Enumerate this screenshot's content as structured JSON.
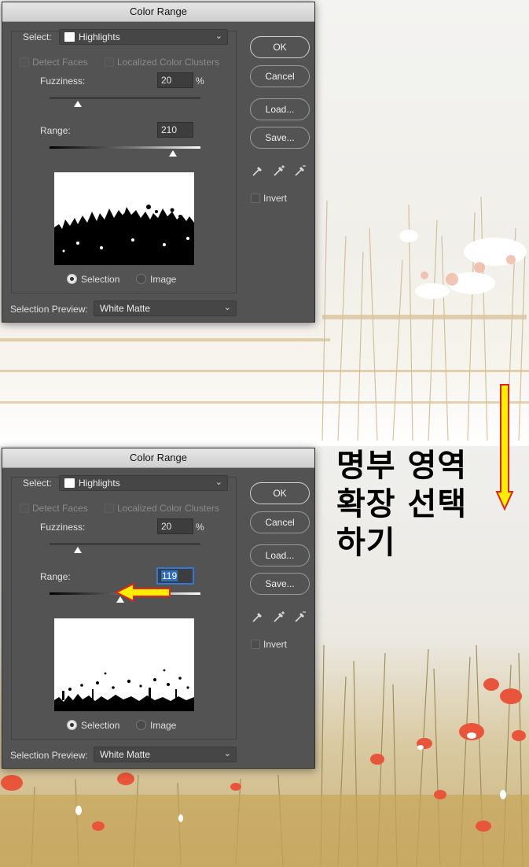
{
  "dialogs": [
    {
      "title": "Color Range",
      "select_label": "Select:",
      "select_value": "Highlights",
      "detect_faces": "Detect Faces",
      "localized_clusters": "Localized Color Clusters",
      "fuzziness_label": "Fuzziness:",
      "fuzziness_value": "20",
      "fuzziness_unit": "%",
      "fuzziness_level": 0.19,
      "range_label": "Range:",
      "range_value": "210",
      "range_level": 0.82,
      "radio_selection": "Selection",
      "radio_image": "Image",
      "preview_label": "Selection Preview:",
      "preview_value": "White Matte",
      "ok": "OK",
      "cancel": "Cancel",
      "load": "Load...",
      "save": "Save...",
      "invert": "Invert"
    },
    {
      "title": "Color Range",
      "select_label": "Select:",
      "select_value": "Highlights",
      "detect_faces": "Detect Faces",
      "localized_clusters": "Localized Color Clusters",
      "fuzziness_label": "Fuzziness:",
      "fuzziness_value": "20",
      "fuzziness_unit": "%",
      "fuzziness_level": 0.19,
      "range_label": "Range:",
      "range_value": "119",
      "range_level": 0.47,
      "radio_selection": "Selection",
      "radio_image": "Image",
      "preview_label": "Selection Preview:",
      "preview_value": "White Matte",
      "ok": "OK",
      "cancel": "Cancel",
      "load": "Load...",
      "save": "Save...",
      "invert": "Invert"
    }
  ],
  "annotation": {
    "line1": "명부 영역",
    "line2": "확장 선택",
    "line3": "하기"
  },
  "colors": {
    "dialog_bg": "#535353",
    "arrow_fill": "#ffee00",
    "arrow_stroke": "#e0241b",
    "poppy": "#e8553a"
  },
  "icons": [
    "eyedropper-icon",
    "eyedropper-plus-icon",
    "eyedropper-minus-icon",
    "chevron-down-icon"
  ]
}
